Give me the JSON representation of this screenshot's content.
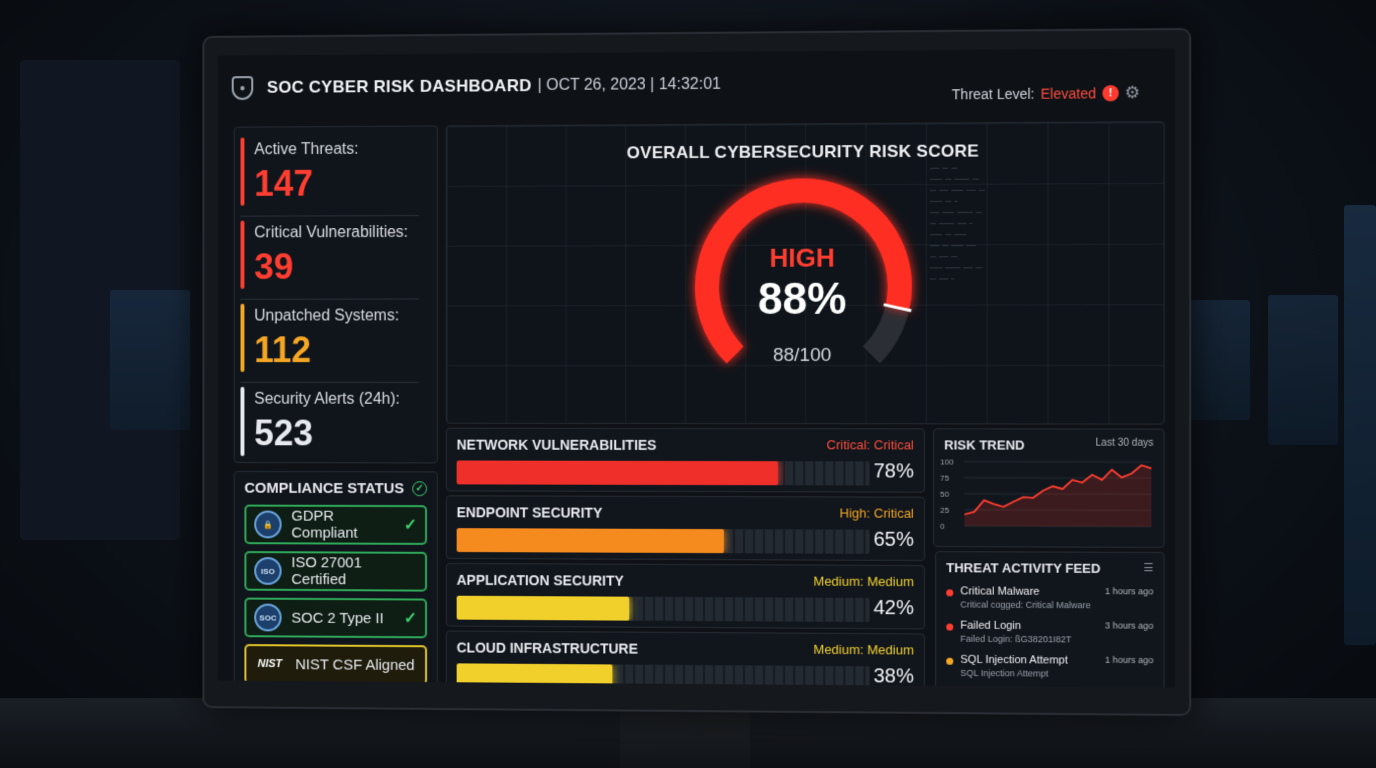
{
  "header": {
    "title": "SOC CYBER RISK DASHBOARD",
    "datetime": "| OCT 26, 2023 | 14:32:01",
    "threat_label": "Threat Level:",
    "threat_value": "Elevated",
    "alert_glyph": "!"
  },
  "stats": [
    {
      "label": "Active Threats:",
      "value": "147",
      "color": "#ff3d30"
    },
    {
      "label": "Critical Vulnerabilities:",
      "value": "39",
      "color": "#ff3d30"
    },
    {
      "label": "Unpatched Systems:",
      "value": "112",
      "color": "#f5a623"
    },
    {
      "label": "Security Alerts (24h):",
      "value": "523",
      "color": "#e6e9ee"
    }
  ],
  "compliance": {
    "title": "COMPLIANCE STATUS",
    "items": [
      {
        "label": "GDPR Compliant",
        "icon": "gdpr-icon",
        "checked": true
      },
      {
        "label": "ISO 27001 Certified",
        "icon": "iso-icon",
        "checked": false
      },
      {
        "label": "SOC 2 Type II",
        "icon": "soc-icon",
        "checked": true
      },
      {
        "label": "NIST CSF Aligned",
        "icon": "nist-logo",
        "icon_text": "NIST",
        "checked": false
      }
    ]
  },
  "gauge": {
    "title": "OVERALL CYBERSECURITY RISK SCORE",
    "level": "HIGH",
    "percent": "88%",
    "score": "88/100",
    "value": 88,
    "max": 100
  },
  "categories": [
    {
      "name": "NETWORK VULNERABILITIES",
      "severity": "Critical: Critical",
      "percent": "78%",
      "value": 78,
      "color": "#ef2f2a",
      "sev_color": "#ff4d3d"
    },
    {
      "name": "ENDPOINT SECURITY",
      "severity": "High: Critical",
      "percent": "65%",
      "value": 65,
      "color": "#f58a1f",
      "sev_color": "#f5a623"
    },
    {
      "name": "APPLICATION SECURITY",
      "severity": "Medium: Medium",
      "percent": "42%",
      "value": 42,
      "color": "#f2d02c",
      "sev_color": "#f2d02c"
    },
    {
      "name": "CLOUD INFRASTRUCTURE",
      "severity": "Medium: Medium",
      "percent": "38%",
      "value": 38,
      "color": "#f2d02c",
      "sev_color": "#f2d02c"
    }
  ],
  "trend": {
    "title": "RISK TREND",
    "subtitle": "Last 30 days",
    "y_ticks": [
      "100",
      "75",
      "50",
      "25",
      "0"
    ],
    "values": [
      18,
      22,
      40,
      34,
      30,
      38,
      45,
      44,
      55,
      62,
      58,
      72,
      68,
      80,
      72,
      88,
      76,
      82,
      95,
      90
    ]
  },
  "feed": {
    "title": "THREAT ACTIVITY FEED",
    "items": [
      {
        "name": "Critical Malware",
        "detail": "Critical cogged: Critical Malware",
        "time": "1 hours ago",
        "color": "#ff3d30"
      },
      {
        "name": "Failed Login",
        "detail": "Failed Login: ßG38201I82T",
        "time": "3 hours ago",
        "color": "#ff3d30"
      },
      {
        "name": "SQL Injection Attempt",
        "detail": "SQL Injection Attempt",
        "time": "1 hours ago",
        "color": "#f5a623"
      }
    ]
  },
  "colors": {
    "critical": "#ff3d30",
    "high": "#f58a1f",
    "medium": "#f2d02c",
    "ok": "#3ecf6a"
  }
}
